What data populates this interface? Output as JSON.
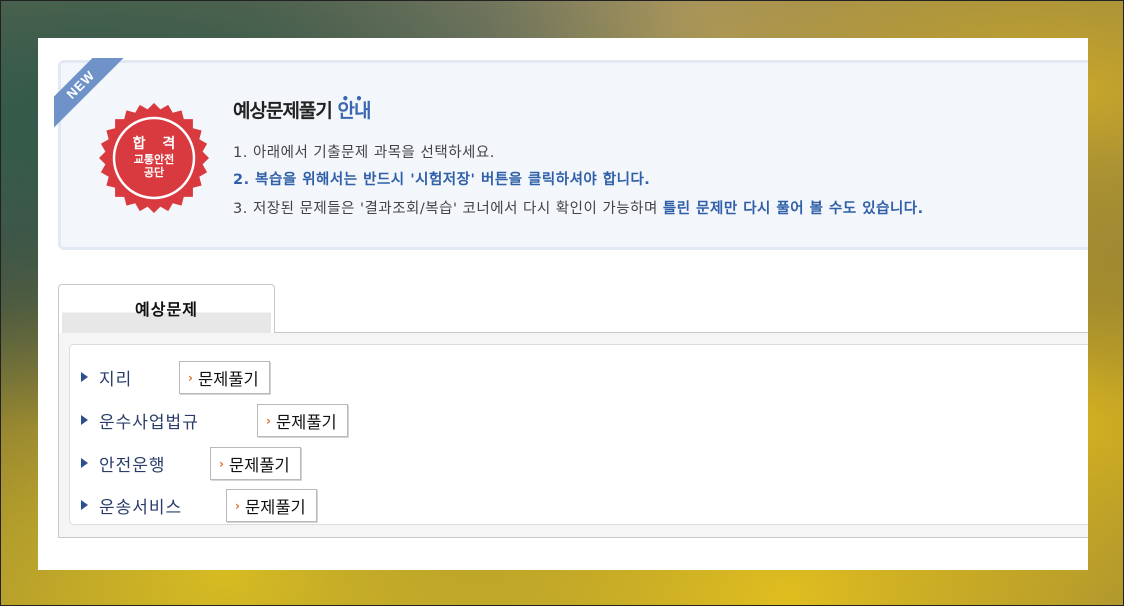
{
  "info": {
    "ribbon": "NEW",
    "seal": {
      "line1": "합 격",
      "line2": "교통안전",
      "line3": "공단",
      "color": "#d83a3f"
    },
    "title_main": "예상문제풀기",
    "title_accent": "안내",
    "lines": [
      "1. 아래에서 기출문제 과목을 선택하세요.",
      "2. 복습을 위해서는 반드시 '시험저장' 버튼을 클릭하셔야 합니다.",
      "3. 저장된 문제들은 '결과조회/복습' 코너에서 다시 확인이 가능하며 "
    ],
    "line3_highlight": "틀린 문제만 다시 풀어 볼 수도 있습니다."
  },
  "tab": {
    "label": "예상문제"
  },
  "subjects": [
    {
      "name": "지리",
      "button": "문제풀기"
    },
    {
      "name": "운수사업법규",
      "button": "문제풀기"
    },
    {
      "name": "안전운행",
      "button": "문제풀기"
    },
    {
      "name": "운송서비스",
      "button": "문제풀기"
    }
  ],
  "colors": {
    "accent_blue": "#2f5fa8",
    "ribbon_blue": "#6f93c9",
    "chevron_orange": "#e0702a"
  }
}
